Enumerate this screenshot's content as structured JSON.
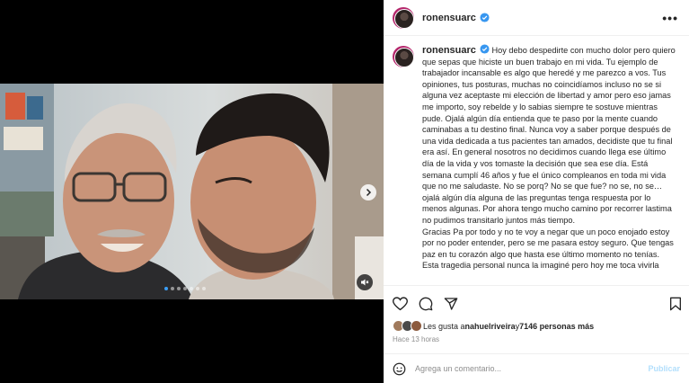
{
  "post": {
    "username": "ronensuarc",
    "more_icon": "more-horizontal-icon",
    "verified_icon": "verified-badge-icon",
    "caption": "Hoy debo despedirte con mucho dolor pero quiero que sepas que hiciste un buen trabajo en mi vida. Tu ejemplo de trabajador incansable es algo que heredé y me parezco a vos. Tus opiniones, tus posturas, muchas no coincidíamos incluso no se si alguna vez aceptaste mi elección de libertad y amor pero eso jamas me importo, soy rebelde y lo sabias siempre te sostuve mientras pude. Ojalá algún día entienda que te paso por la mente cuando caminabas a tu destino final. Nunca voy a saber porque después de una vida dedicada a tus pacientes tan amados, decidiste que tu final era así. En general nosotros no decidimos cuando llega ese último día de la vida y vos tomaste la decisión que sea ese día. Está semana cumplí 46 años y fue el único compleanos en toda mi vida que no me saludaste. No se porq? No se que fue? no se, no se… ojalá algún día alguna de las preguntas tenga respuesta por lo menos algunas. Por ahora tengo mucho camino por recorrer lastima no pudimos transitarlo juntos más tiempo.\nGracias Pa por todo y no te voy a negar que un poco enojado estoy por no poder entender, pero se me pasara estoy seguro. Que tengas paz en tu corazón algo que hasta ese último momento no tenías.\nEsta tragedia personal nunca la imaginé pero hoy me toca vivirla"
  },
  "media": {
    "dot_count": 7,
    "active_dot": 0,
    "next_icon": "chevron-right-icon",
    "mute_icon": "speaker-muted-icon"
  },
  "actions": {
    "icons": [
      "heart-icon",
      "comment-icon",
      "share-icon",
      "bookmark-icon"
    ]
  },
  "likes": {
    "prefix": "Les gusta a ",
    "user": "nahuelriveira",
    "middle": " y ",
    "count": "7146 personas más"
  },
  "timestamp": "Hace 13 horas",
  "comment": {
    "placeholder": "Agrega un comentario...",
    "publish_label": "Publicar",
    "emoji_icon": "emoji-icon"
  },
  "colors": {
    "verified": "#3897f0",
    "active_dot": "#3b9ef5",
    "publish": "#b2dffc"
  }
}
